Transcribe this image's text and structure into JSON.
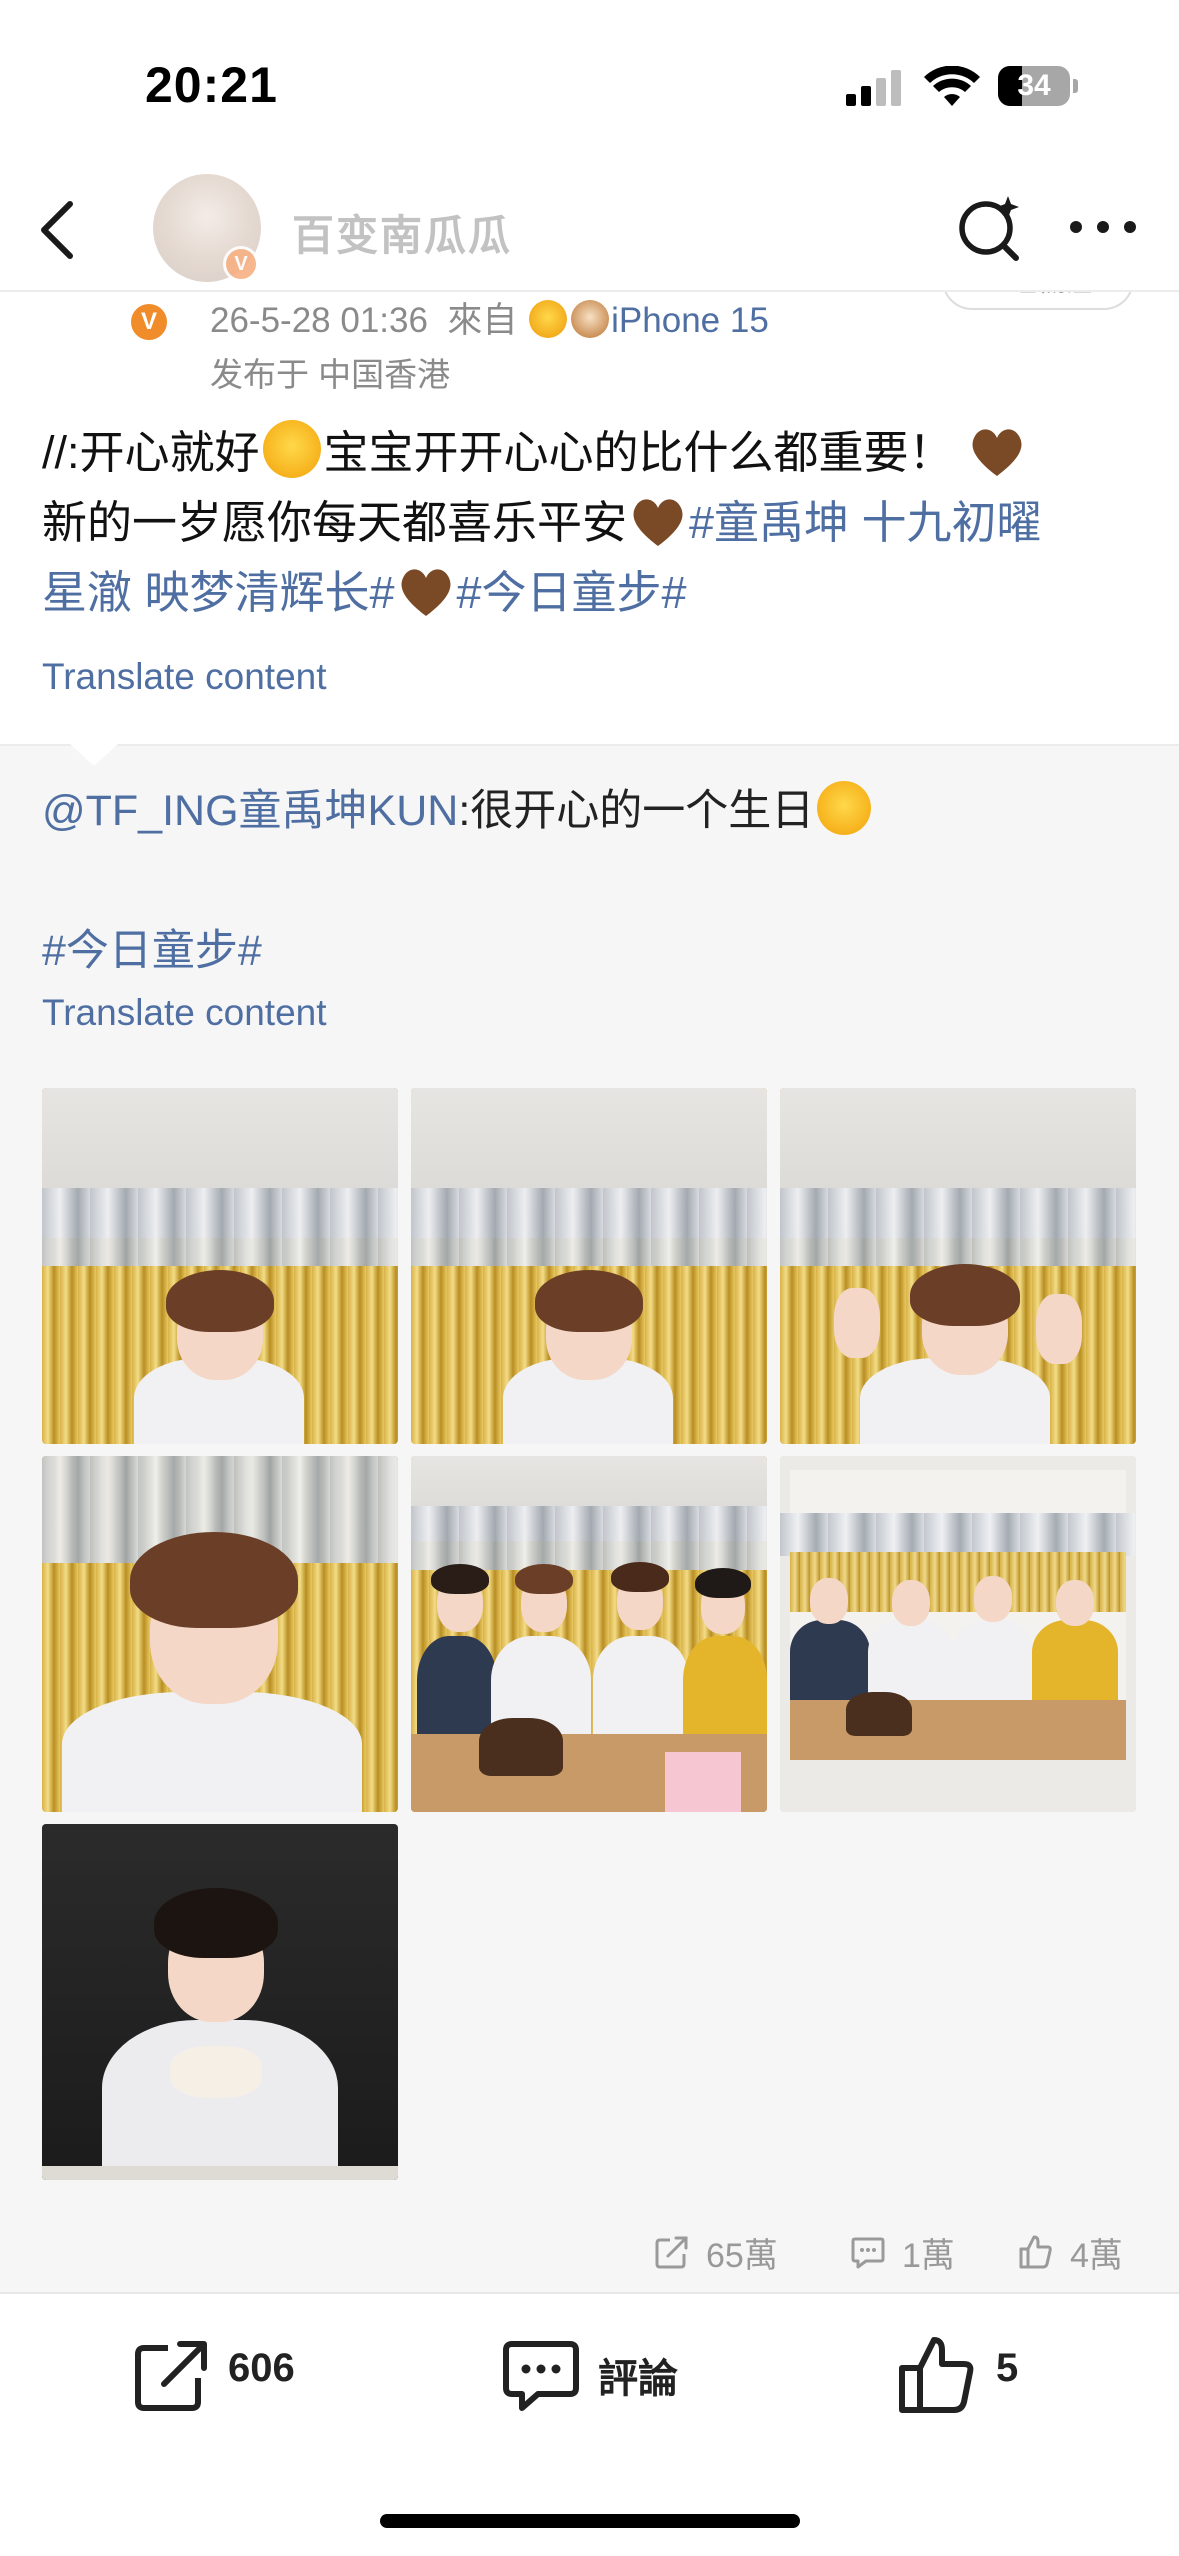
{
  "status_bar": {
    "time": "20:21",
    "battery": "34",
    "battery_level": 0.34
  },
  "nav": {
    "title": "百变南瓜瓜",
    "verified_badge": "V"
  },
  "post": {
    "verified_badge": "V",
    "follow_label": "已關注",
    "meta_time": "26-5-28 01:36",
    "meta_from": "來自",
    "meta_device": "iPhone 15",
    "location": "发布于 中国香港",
    "body_prefix": "//:开心就好",
    "body_mid": "宝宝开开心心的比什么都重要！",
    "body_line2": "新的一岁愿你每天都喜乐平安",
    "tag1": "#童禹坤 十九初曜",
    "tag1_cont": "星澈 映梦清辉长#",
    "tag2": "#今日童步#",
    "translate_label": "Translate content"
  },
  "repost": {
    "user": "@TF_ING童禹坤KUN",
    "text": ":很开心的一个生日",
    "tag": "#今日童步#",
    "translate_label": "Translate content",
    "images": [
      {
        "label": "birthday-photo-1"
      },
      {
        "label": "birthday-photo-2"
      },
      {
        "label": "birthday-photo-3"
      },
      {
        "label": "birthday-photo-4"
      },
      {
        "label": "birthday-photo-5"
      },
      {
        "label": "birthday-photo-6"
      },
      {
        "label": "birthday-photo-7"
      }
    ],
    "stats": {
      "shares": "65萬",
      "comments": "1萬",
      "likes": "4萬"
    }
  },
  "bottom_bar": {
    "share_count": "606",
    "comment_label": "評論",
    "like_count": "5"
  },
  "colors": {
    "link": "#4f6fa3",
    "accent_badge": "#f08c2a"
  },
  "icons": [
    "back-icon",
    "search-icon",
    "more-icon",
    "share-icon",
    "comment-icon",
    "like-icon"
  ]
}
